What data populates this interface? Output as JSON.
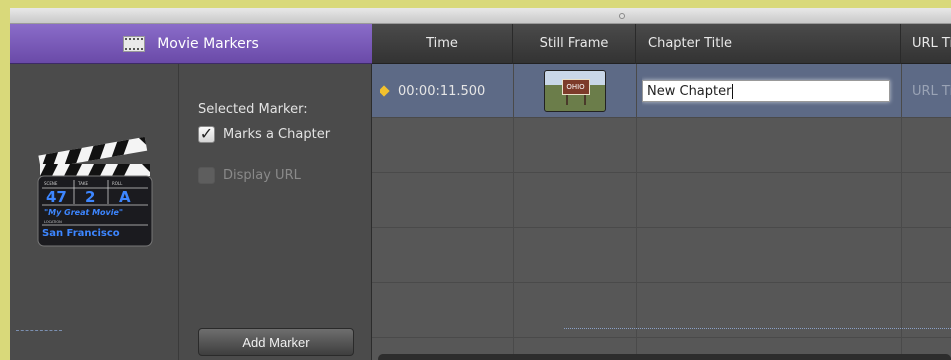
{
  "panel": {
    "title": "Movie Markers",
    "selected_marker_label": "Selected Marker:",
    "marks_chapter_label": "Marks a Chapter",
    "marks_chapter_checked": true,
    "display_url_label": "Display URL",
    "display_url_checked": false,
    "add_marker_label": "Add Marker",
    "clapboard": {
      "scene": "47",
      "take": "2",
      "roll": "A",
      "scene_label": "SCENE",
      "take_label": "TAKE",
      "roll_label": "ROLL",
      "title_line": "\"My Great Movie\"",
      "location_label": "LOCATION",
      "location": "San Francisco"
    }
  },
  "table": {
    "headers": {
      "time": "Time",
      "still_frame": "Still Frame",
      "chapter_title": "Chapter Title",
      "url": "URL Title"
    },
    "rows": [
      {
        "time": "00:00:11.500",
        "chapter_title": "New Chapter",
        "url": "URL Title",
        "still_frame_caption": "OHIO"
      }
    ]
  },
  "colors": {
    "header_accent": "#7a5cb8",
    "selected_row": "#5d6a86",
    "marker_diamond": "#f2c12e",
    "outer_border": "#d9d97a"
  }
}
